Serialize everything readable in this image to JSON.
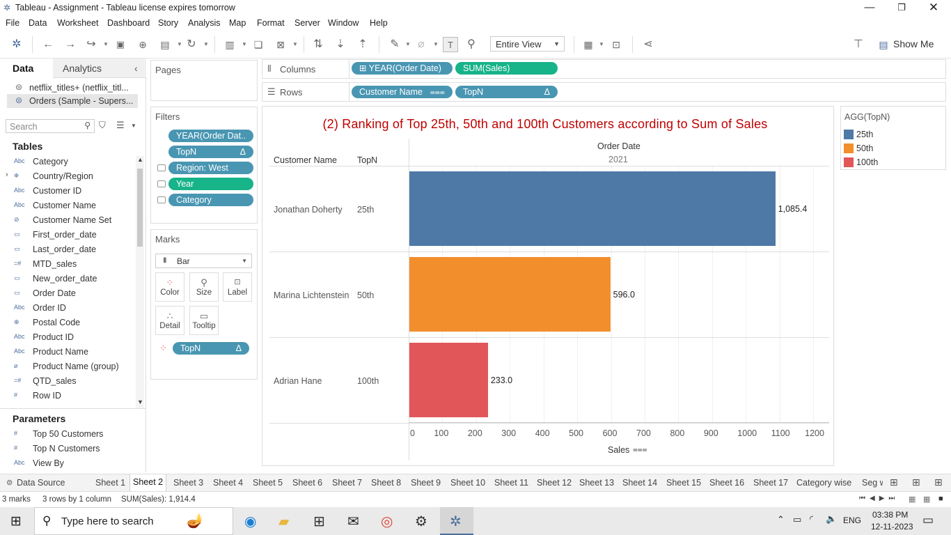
{
  "window": {
    "title": "Tableau - Assignment - Tableau license expires tomorrow",
    "min_icon": "minimize-icon",
    "restore_icon": "restore-icon",
    "close_icon": "close-icon"
  },
  "menu": [
    "File",
    "Data",
    "Worksheet",
    "Dashboard",
    "Story",
    "Analysis",
    "Map",
    "Format",
    "Server",
    "Window",
    "Help"
  ],
  "toolbar": {
    "fit_value": "Entire View",
    "show_me": "Show Me"
  },
  "data_pane": {
    "tabs": [
      "Data",
      "Analytics"
    ],
    "datasources": [
      "netflix_titles+ (netflix_titl...",
      "Orders (Sample - Supers..."
    ],
    "search_placeholder": "Search",
    "tables_header": "Tables",
    "fields": [
      {
        "type": "Abc",
        "name": "Category"
      },
      {
        "type": "geo",
        "name": "Country/Region"
      },
      {
        "type": "Abc",
        "name": "Customer ID"
      },
      {
        "type": "Abc",
        "name": "Customer Name"
      },
      {
        "type": "set",
        "name": "Customer Name Set"
      },
      {
        "type": "date",
        "name": "First_order_date"
      },
      {
        "type": "date",
        "name": "Last_order_date"
      },
      {
        "type": "=#",
        "name": "MTD_sales"
      },
      {
        "type": "date",
        "name": "New_order_date"
      },
      {
        "type": "date",
        "name": "Order Date"
      },
      {
        "type": "Abc",
        "name": "Order ID"
      },
      {
        "type": "globe",
        "name": "Postal Code"
      },
      {
        "type": "Abc",
        "name": "Product ID"
      },
      {
        "type": "Abc",
        "name": "Product Name"
      },
      {
        "type": "group",
        "name": "Product Name (group)"
      },
      {
        "type": "=#",
        "name": "QTD_sales"
      },
      {
        "type": "#",
        "name": "Row ID"
      }
    ],
    "parameters_header": "Parameters",
    "parameters": [
      {
        "type": "#",
        "name": "Top 50 Customers"
      },
      {
        "type": "#",
        "name": "Top N Customers"
      },
      {
        "type": "Abc",
        "name": "View By"
      }
    ]
  },
  "pages": {
    "title": "Pages"
  },
  "filters": {
    "title": "Filters",
    "items": [
      "YEAR(Order Dat..",
      "TopN",
      "Region: West",
      "Year",
      "Category"
    ]
  },
  "marks": {
    "title": "Marks",
    "type": "Bar",
    "buttons": [
      "Color",
      "Size",
      "Label",
      "Detail",
      "Tooltip"
    ],
    "pill": "TopN"
  },
  "shelves": {
    "columns_label": "Columns",
    "rows_label": "Rows",
    "columns": [
      "YEAR(Order Date)",
      "SUM(Sales)"
    ],
    "rows": [
      "Customer Name",
      "TopN"
    ]
  },
  "legend": {
    "title": "AGG(TopN)",
    "items": [
      {
        "label": "25th",
        "color": "#4e79a7"
      },
      {
        "label": "50th",
        "color": "#f28e2b"
      },
      {
        "label": "100th",
        "color": "#e15759"
      }
    ]
  },
  "chart_data": {
    "type": "bar",
    "title": "(2) Ranking of Top 25th, 50th and 100th Customers according to Sum of Sales",
    "header_col1": "Customer Name",
    "header_col2": "TopN",
    "column_header": "Order Date",
    "column_value": "2021",
    "categories": [
      "Jonathan Doherty",
      "Marina Lichtenstein",
      "Adrian Hane"
    ],
    "topn": [
      "25th",
      "50th",
      "100th"
    ],
    "values": [
      1085.4,
      596.0,
      233.0
    ],
    "value_labels": [
      "1,085.4",
      "596.0",
      "233.0"
    ],
    "colors": [
      "#4e79a7",
      "#f28e2b",
      "#e15759"
    ],
    "xlabel": "Sales",
    "xlim": [
      0,
      1250
    ],
    "xticks": [
      0,
      100,
      200,
      300,
      400,
      500,
      600,
      700,
      800,
      900,
      1000,
      1100,
      1200
    ]
  },
  "sheet_tabs": {
    "items": [
      "Data Source",
      "Sheet 1",
      "Sheet 2",
      "Sheet 3",
      "Sheet 4",
      "Sheet 5",
      "Sheet 6",
      "Sheet 7",
      "Sheet 8",
      "Sheet 9",
      "Sheet 10",
      "Sheet 11",
      "Sheet 12",
      "Sheet 13",
      "Sheet 14",
      "Sheet 15",
      "Sheet 16",
      "Sheet 17",
      "Category wise",
      "Seg w"
    ],
    "active": "Sheet 2"
  },
  "status": {
    "marks": "3 marks",
    "rows": "3 rows by 1 column",
    "sum": "SUM(Sales): 1,914.4"
  },
  "taskbar": {
    "search_placeholder": "Type here to search",
    "lang": "ENG",
    "time": "03:38 PM",
    "date": "12-11-2023"
  }
}
